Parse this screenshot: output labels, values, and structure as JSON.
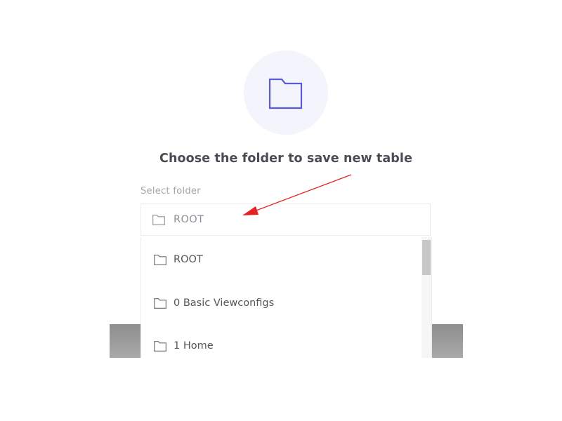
{
  "dialog": {
    "title": "Choose the folder to save new table",
    "select_label": "Select folder",
    "selected_folder": "ROOT",
    "accent_color": "#5b5bd6"
  },
  "dropdown": {
    "options": [
      {
        "label": "ROOT",
        "icon": "folder-icon"
      },
      {
        "label": "0 Basic Viewconfigs",
        "icon": "folder-icon"
      },
      {
        "label": "1 Home",
        "icon": "folder-icon"
      }
    ]
  },
  "annotation": {
    "arrow_color": "#e52222",
    "points_to": "selected_folder"
  }
}
